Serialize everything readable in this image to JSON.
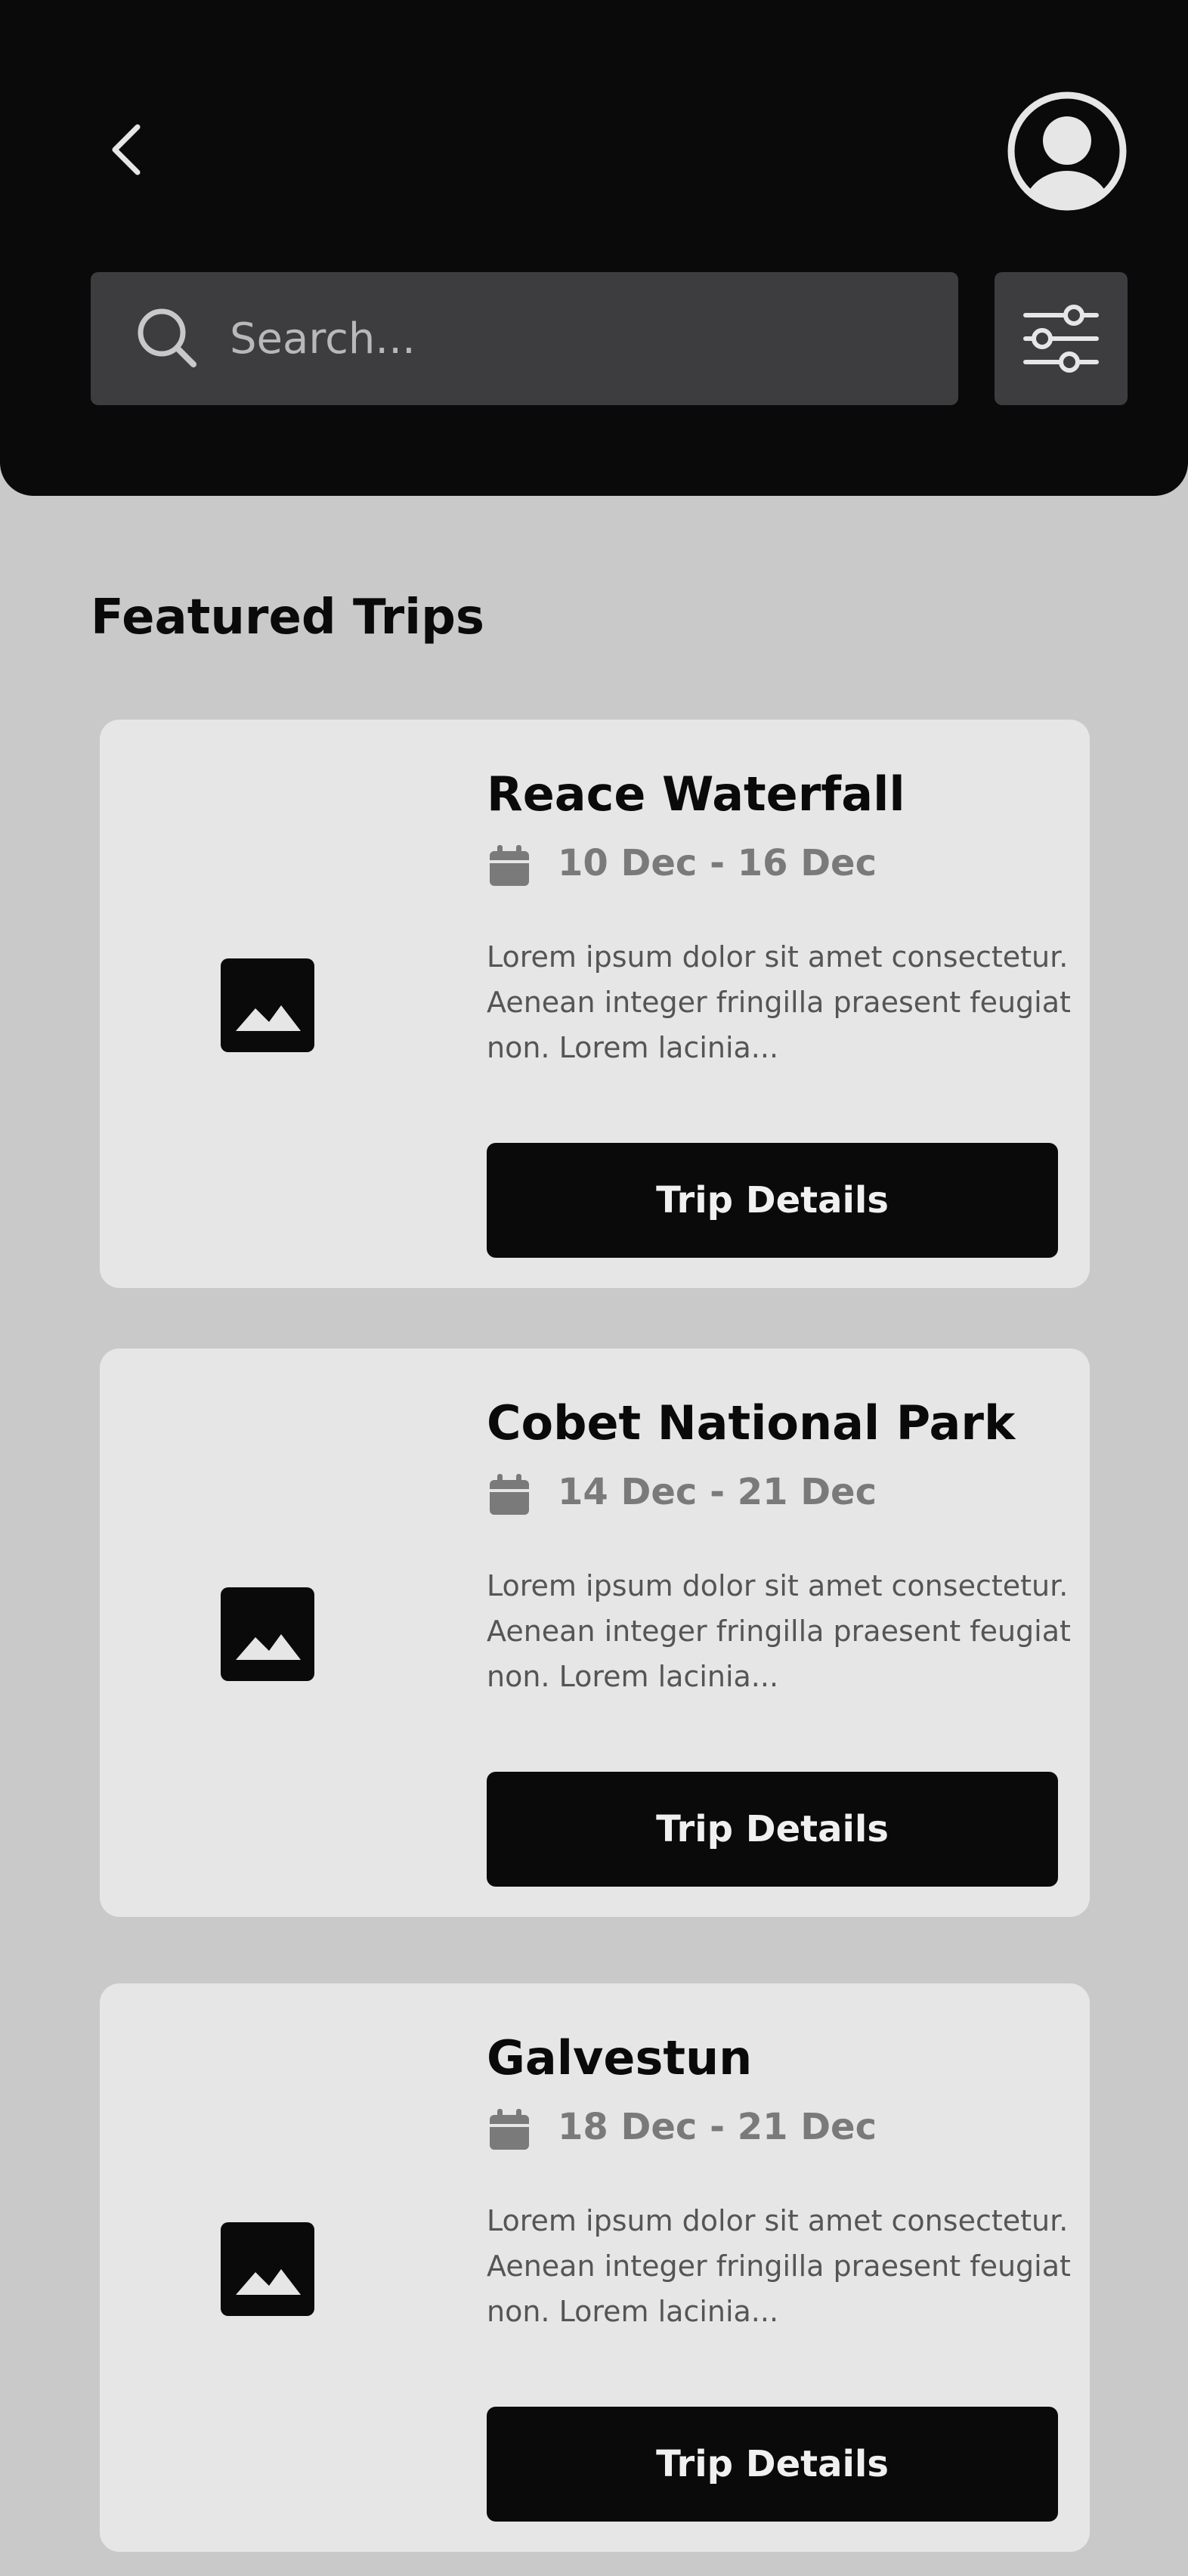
{
  "header": {
    "back_icon": "chevron-left-icon",
    "profile_icon": "user-circle-icon",
    "search": {
      "placeholder": "Search...",
      "value": "",
      "icon": "search-icon"
    },
    "filter_icon": "sliders-icon"
  },
  "section": {
    "title": "Featured Trips"
  },
  "trips": [
    {
      "title": "Reace Waterfall",
      "dates": "10 Dec - 16 Dec",
      "description": "Lorem ipsum dolor sit amet consectetur. Aenean integer fringilla praesent feugiat non. Lorem lacinia...",
      "button_label": "Trip Details",
      "image_icon": "image-placeholder-icon"
    },
    {
      "title": "Cobet National Park",
      "dates": "14 Dec - 21 Dec",
      "description": "Lorem ipsum dolor sit amet consectetur. Aenean integer fringilla praesent feugiat non. Lorem lacinia...",
      "button_label": "Trip Details",
      "image_icon": "image-placeholder-icon"
    },
    {
      "title": "Galvestun",
      "dates": "18 Dec - 21 Dec",
      "description": "Lorem ipsum dolor sit amet consectetur. Aenean integer fringilla praesent feugiat non. Lorem lacinia...",
      "button_label": "Trip Details",
      "image_icon": "image-placeholder-icon"
    }
  ],
  "colors": {
    "header_bg": "#0a0a0b",
    "page_bg": "#c9c9c9",
    "card_bg": "#e6e6e6",
    "search_bg": "#3d3d3f",
    "button_bg": "#0a0a0b",
    "date_text": "#7a7a7a"
  }
}
